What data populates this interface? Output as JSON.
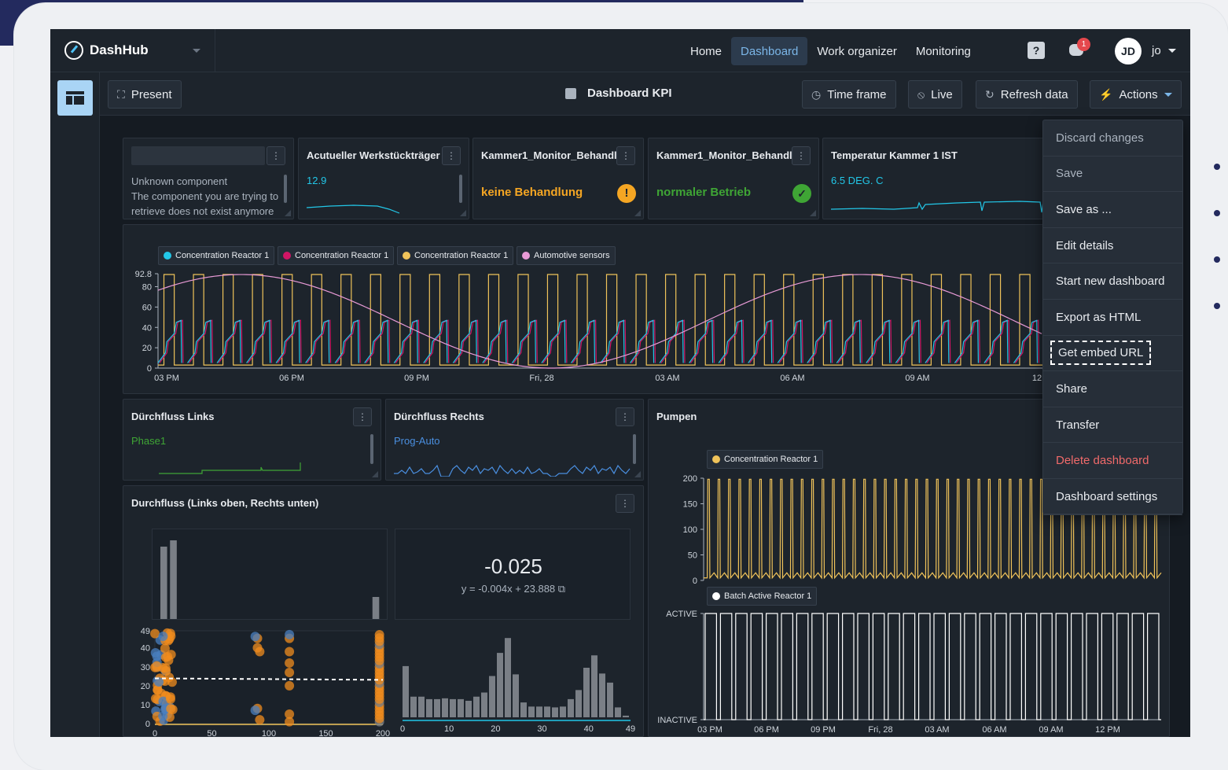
{
  "app": {
    "name": "DashHub"
  },
  "nav": {
    "items": [
      "Home",
      "Dashboard",
      "Work organizer",
      "Monitoring"
    ],
    "active": "Dashboard"
  },
  "header": {
    "notifications_count": "1",
    "user_initials": "JD",
    "user_name": "jo",
    "help_label": "?"
  },
  "toolbar": {
    "present_label": "Present",
    "title": "Dashboard KPI",
    "timeframe_label": "Time frame",
    "live_label": "Live",
    "refresh_label": "Refresh data",
    "actions_label": "Actions"
  },
  "actions_menu": {
    "items": [
      "Discard changes",
      "Save",
      "Save as ...",
      "Edit details",
      "Start new dashboard",
      "Export as HTML",
      "Get embed URL",
      "Share",
      "Transfer",
      "Delete dashboard",
      "Dashboard settings"
    ],
    "disabled": [
      "Discard changes",
      "Save"
    ],
    "danger": [
      "Delete dashboard"
    ],
    "focused": "Get embed URL"
  },
  "widgets": {
    "unknown": {
      "line1": "Unknown component",
      "line2": "The component you are trying to",
      "line3": "retrieve does not exist anymore"
    },
    "werkstueck": {
      "title": "Acutueller Werkstückträger",
      "value": "12.9"
    },
    "kammer_a": {
      "title": "Kammer1_Monitor_Behandl",
      "status": "keine Behandlung",
      "status_icon": "!"
    },
    "kammer_b": {
      "title": "Kammer1_Monitor_Behandl",
      "status": "normaler Betrieb",
      "status_icon": "✓"
    },
    "temperatur": {
      "title": "Temperatur Kammer 1 IST",
      "value": "6.5 DEG. C"
    },
    "durchfluss_links": {
      "title": "Dürchfluss Links",
      "value": "Phase1"
    },
    "durchfluss_rechts": {
      "title": "Dürchfluss Rechts",
      "value": "Prog-Auto"
    },
    "durchfluss": {
      "title": "Durchfluss (Links oben, Rechts unten)",
      "stat_value": "-0.025",
      "equation": "y = -0.004x + 23.888",
      "copy_icon": "⧉"
    },
    "pumpen": {
      "title": "Pumpen"
    }
  },
  "colors": {
    "cyan": "#22c7e8",
    "magenta": "#d11565",
    "yellow": "#f0c35a",
    "pink": "#e89ad6",
    "green": "#3fa535",
    "blue": "#4a8fe0",
    "orange": "#f08c1e",
    "accent": "#7bb6e8"
  },
  "icons": {
    "present": "⛶",
    "timeframe": "◷",
    "live": "⦸",
    "refresh": "↻",
    "actions": "⚡",
    "save": "▪"
  },
  "chart_data": [
    {
      "type": "line",
      "panel": "main-trend",
      "series": [
        {
          "name": "Concentration Reactor 1",
          "color": "#22c7e8"
        },
        {
          "name": "Concentration Reactor 1",
          "color": "#d11565"
        },
        {
          "name": "Concentration Reactor 1",
          "color": "#f0c35a"
        },
        {
          "name": "Automotive sensors",
          "color": "#e89ad6"
        }
      ],
      "x_ticks": [
        "03 PM",
        "06 PM",
        "09 PM",
        "Fri, 28",
        "03 AM",
        "06 AM",
        "09 AM",
        "12"
      ],
      "y_ticks": [
        0,
        20,
        40,
        60,
        80,
        92.8
      ],
      "ylim": [
        0,
        92.8
      ],
      "cycles": 30
    },
    {
      "type": "line",
      "panel": "pumpen-top",
      "series": [
        {
          "name": "Concentration Reactor 1",
          "color": "#f0c35a"
        }
      ],
      "y_ticks": [
        0,
        50,
        100,
        150,
        200
      ],
      "ylim": [
        0,
        200
      ],
      "cycles": 44
    },
    {
      "type": "line",
      "panel": "pumpen-bottom",
      "series": [
        {
          "name": "Batch Active Reactor 1",
          "color": "#ffffff"
        }
      ],
      "y_ticks": [
        "INACTIVE",
        "ACTIVE"
      ],
      "x_ticks": [
        "03 PM",
        "06 PM",
        "09 PM",
        "Fri, 28",
        "03 AM",
        "06 AM",
        "09 AM",
        "12 PM"
      ],
      "cycles": 30
    },
    {
      "type": "bar",
      "panel": "hist-top",
      "values": [
        92,
        100,
        0,
        0,
        0,
        0,
        0,
        0,
        0,
        0,
        0,
        0,
        0,
        0,
        0,
        0,
        0,
        0,
        0,
        0,
        0,
        0,
        28
      ]
    },
    {
      "type": "scatter",
      "panel": "scatter",
      "x_ticks": [
        0,
        50,
        100,
        150,
        200
      ],
      "y_ticks": [
        0,
        10,
        20,
        30,
        40,
        49
      ],
      "xlim": [
        0,
        200
      ],
      "ylim": [
        0,
        49
      ],
      "trend": {
        "slope": -0.004,
        "intercept": 23.888
      }
    },
    {
      "type": "bar",
      "panel": "hist-bottom",
      "x_ticks": [
        0,
        10,
        20,
        30,
        40,
        49
      ],
      "values": [
        62,
        25,
        25,
        22,
        22,
        23,
        22,
        22,
        20,
        25,
        30,
        50,
        78,
        96,
        52,
        18,
        13,
        13,
        13,
        12,
        13,
        22,
        33,
        60,
        75,
        53,
        42,
        12,
        2
      ]
    }
  ]
}
